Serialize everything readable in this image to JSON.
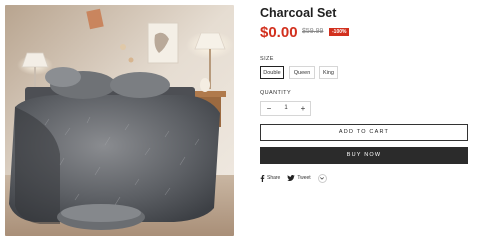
{
  "product": {
    "title": "Charcoal Set",
    "price": "$0.00",
    "compare_price": "$59.99",
    "discount_badge": "-100%"
  },
  "options": {
    "size_label": "SIZE",
    "sizes": [
      "Double",
      "Queen",
      "King"
    ],
    "selected": "Double"
  },
  "quantity": {
    "label": "QUANTITY",
    "value": "1",
    "minus": "−",
    "plus": "+"
  },
  "actions": {
    "add_to_cart": "ADD TO CART",
    "buy_now": "BUY NOW"
  },
  "share": {
    "facebook": "Share",
    "twitter": "Tweet"
  },
  "icons": [
    "facebook-icon",
    "twitter-icon",
    "chevron-down-icon"
  ],
  "colors": {
    "price": "#d2301e",
    "badge": "#d2301e",
    "buy_button": "#2b2b2b"
  }
}
